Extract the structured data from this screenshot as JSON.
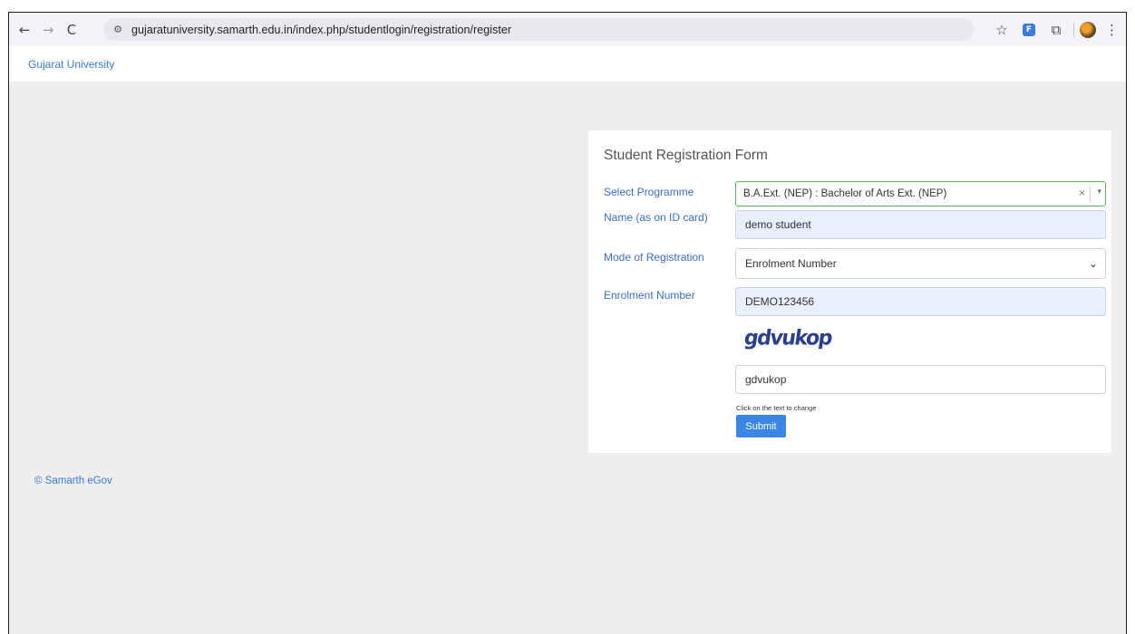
{
  "browser": {
    "url": "gujaratuniversity.samarth.edu.in/index.php/studentlogin/registration/register",
    "back_glyph": "←",
    "forward_glyph": "→",
    "reload_glyph": "C",
    "site_info_glyph": "⚙",
    "star_glyph": "☆",
    "ext1_glyph": "F",
    "ext2_glyph": "⧉",
    "menu_glyph": "⋮"
  },
  "header": {
    "brand": "Gujarat University"
  },
  "form": {
    "title": "Student Registration Form",
    "programme_label": "Select Programme",
    "programme_value": "B.A.Ext. (NEP) : Bachelor of Arts Ext. (NEP)",
    "programme_clear": "×",
    "programme_arrow": "▾",
    "name_label": "Name (as on ID card)",
    "name_value": "demo student",
    "mode_label": "Mode of Registration",
    "mode_value": "Enrolment Number",
    "mode_arrow": "⌄",
    "enrolment_label": "Enrolment Number",
    "enrolment_value": "DEMO123456",
    "captcha_text": "gdvukop",
    "captcha_input_value": "gdvukop",
    "captcha_hint": "Click on the text to change",
    "submit_label": "Submit"
  },
  "footer": {
    "copyright": "© Samarth eGov"
  },
  "colors": {
    "link": "#3a7bd5",
    "label": "#3a6fc2",
    "submit": "#3b86e4",
    "captcha": "#2b3f8f",
    "select_border": "#5cb85c"
  }
}
